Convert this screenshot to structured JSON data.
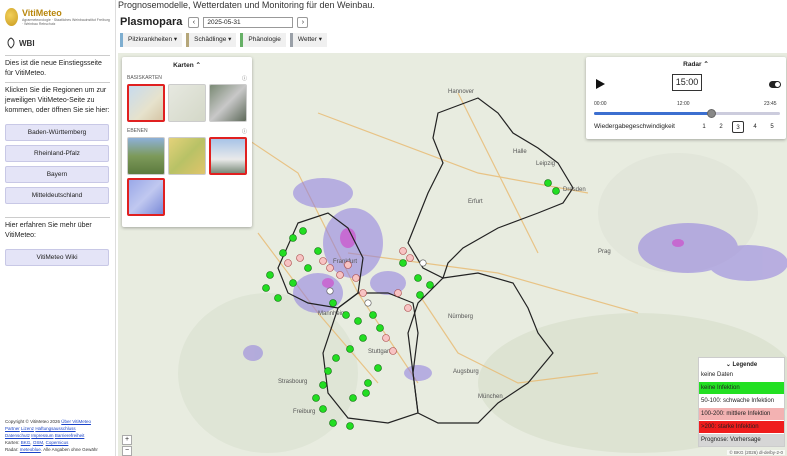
{
  "sidebar": {
    "logo_title": "VitiMeteo",
    "logo_sub": "Agrarmeteorologie · Staatliches Weinbauinstitut Freiburg · Weinbau Rebschutz",
    "wbi_label": "WBI",
    "intro": "Dies ist die neue Einstiegsseite für VitiMeteo.",
    "instruction": "Klicken Sie die Regionen um zur jeweiligen VitiMeteo-Seite zu kommen, oder öffnen Sie sie hier:",
    "regions": [
      "Baden-Württemberg",
      "Rheinland-Pfalz",
      "Bayern",
      "Mitteldeutschland"
    ],
    "more_text": "Hier erfahren Sie mehr über VitiMeteo:",
    "wiki_label": "VitiMeteo Wiki",
    "footer": {
      "line1_prefix": "Copyright © VitiMeteo 2026",
      "line1_link": "Über VitiMeteo",
      "line2": [
        "Partner",
        "Lizenz",
        "Haftungsausschluss"
      ],
      "line3": [
        "Datenschutz",
        "Impressum",
        "Barrierefreiheit"
      ],
      "line4_prefix": "Karten:",
      "line4": [
        "BKG",
        "OSM",
        "Copernicus"
      ],
      "line5_prefix": "Radar:",
      "line5_link": "meteoblue",
      "line5_suffix": "Alle Angaben ohne Gewähr"
    }
  },
  "header": {
    "top_title": "Prognosemodelle, Wetterdaten und Monitoring für den Weinbau.",
    "heading": "Plasmopara",
    "prev": "‹",
    "next": "›",
    "date": "2025-05-31"
  },
  "tabs": [
    {
      "label": "Pilzkrankheiten ▾",
      "color": "#7eaed0"
    },
    {
      "label": "Schädlinge ▾",
      "color": "#b6a77a"
    },
    {
      "label": "Phänologie",
      "color": "#66b066"
    },
    {
      "label": "Wetter ▾",
      "color": "#9aa0a8"
    }
  ],
  "karten": {
    "title": "Karten ⌃",
    "base_label": "BASISKARTEN",
    "layer_label": "EBENEN",
    "info": "ⓘ"
  },
  "radar": {
    "title": "Radar ⌃",
    "time": "15:00",
    "ticks": [
      "00:00",
      "12:00",
      "23:45"
    ],
    "progress": 0.63,
    "speed_label": "Wiedergabegeschwindigkeit",
    "speeds": [
      "1",
      "2",
      "3",
      "4",
      "5"
    ],
    "active_speed": "3"
  },
  "legend": {
    "title": "⌄ Legende",
    "rows": [
      {
        "label": "keine Daten",
        "color": "#ffffff",
        "text": "#222"
      },
      {
        "label": "keine Infektion",
        "color": "#22e022",
        "text": "#222"
      },
      {
        "label": "50-100: schwache Infektion",
        "color": "#ffffff",
        "text": "#222"
      },
      {
        "label": "100-200: mittlere Infektion",
        "color": "#f3b2b2",
        "text": "#222"
      },
      {
        "label": ">200: starke Infektion",
        "color": "#ef1c1c",
        "text": "#222"
      },
      {
        "label": "Prognose: Vorhersage",
        "color": "#d6d6d6",
        "text": "#222"
      }
    ]
  },
  "map": {
    "cities": [
      "Hannover",
      "Halle",
      "Leipzig",
      "Dresden",
      "Erfurt",
      "Frankfurt",
      "Mannheim",
      "Stuttgart",
      "Nürnberg",
      "Augsburg",
      "München",
      "Strasbourg",
      "Freiburg",
      "Prag"
    ],
    "zoom_in": "+",
    "zoom_out": "−",
    "attribution": "© BKG (2026) dl-de/by-2-0"
  }
}
